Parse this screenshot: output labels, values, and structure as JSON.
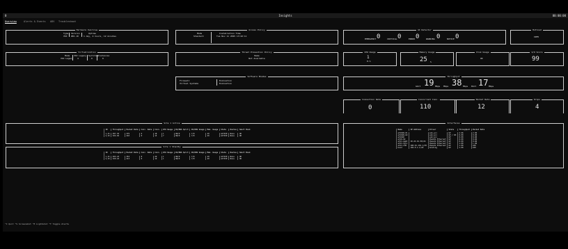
{
  "window": {
    "title": "Insights",
    "left_mark": "0",
    "clock": "00:00:00"
  },
  "tabs": [
    "Overview",
    "Alerts & Events",
    "ADV",
    "Troubleshoot"
  ],
  "hardware": {
    "title": "Hardware Overview",
    "headers": [
      "Type",
      "Version",
      "Uptime"
    ],
    "values": [
      "VSX",
      "R81.10",
      "1 day, 4 hours, 12 minutes"
    ]
  },
  "access_policy": {
    "title": "Access Policy",
    "left_header": "Mode",
    "left_value": "Standard",
    "right_header": "Installation Time",
    "right_value": "Tue Nov 11 2025 13:42:11"
  },
  "ai_detector": {
    "title": "AI Detector",
    "labels": [
      "EMERGENCY",
      "CRITICAL",
      "ERROR",
      "WARNING",
      "NOTICE"
    ],
    "values": [
      "0",
      "0",
      "0",
      "0",
      "0"
    ]
  },
  "hotload": {
    "title": "Hotload",
    "value": "INFO"
  },
  "virtualization": {
    "title": "Virtualization",
    "headers": [
      "Mode",
      "VSX Legacy",
      "Switches",
      "Instances"
    ],
    "row_label": "VSX Legacy",
    "values": [
      "4",
      "0",
      "0"
    ]
  },
  "threat_prevention": {
    "title": "Threat Prevention Policy",
    "label": "Name",
    "value": "Not Available"
  },
  "cpu": {
    "title": "CPU Usage",
    "value": "1",
    "unit": "0.%"
  },
  "memory": {
    "title": "Memory Usage",
    "value": "25",
    "unit": "%"
  },
  "disk": {
    "title": "Disk Usage",
    "value": "OK"
  },
  "io": {
    "title": "I/O Score",
    "value": "99"
  },
  "software_blades": {
    "title": "Software Blades",
    "items": [
      {
        "name": "Firewall",
        "status": "Evaluation"
      },
      {
        "name": "Virtual Systems",
        "status": "Evaluation"
      }
    ]
  },
  "throughput": {
    "title": "Throughput",
    "labels": [
      "Gbit",
      "Mbps",
      "Kbit"
    ],
    "values": [
      "19",
      "38",
      "17"
    ],
    "units": [
      "Mbps",
      "Mbps",
      "Mbps"
    ]
  },
  "kpis": [
    {
      "title": "Connection Rate",
      "value": "0"
    },
    {
      "title": "Concurrent Conn.",
      "value": "110"
    },
    {
      "title": "Packet Rate",
      "value": "12"
    },
    {
      "title": "Drops",
      "value": "4"
    }
  ],
  "vs_active": {
    "title": "Site 1 Active",
    "headers": [
      "ID",
      "Throughput",
      "Packet Rate",
      "Conc. Rate",
      "Conn.",
      "CPU Usage",
      "PA/DNS Split",
      "PA/DNS Usage",
      "Mem. Usage",
      "State",
      "Routes",
      "Smart Book"
    ],
    "rows": [
      [
        "1,41",
        "497.35",
        "379",
        "6",
        "18",
        "1",
        "98/0",
        "7/0",
        "29",
        "ACTIVE",
        "None",
        "OK"
      ],
      [
        "2,32",
        "324.02",
        "210",
        "0",
        "15",
        "7",
        "98/0",
        "7/0",
        "29",
        "ACTIVE",
        "None",
        "OK"
      ]
    ]
  },
  "vs_standby": {
    "title": "Site 1 Standby",
    "headers": [
      "ID",
      "Throughput",
      "Packet Rate",
      "Conc. Rate",
      "Conn.",
      "CPU Usage",
      "PA/DNS Split",
      "PA/DNS Usage",
      "Mem. Usage",
      "State",
      "Routes",
      "Smart Book"
    ],
    "rows": [
      [
        "1,41",
        "493.23",
        "353",
        "8",
        "20",
        "1",
        "98/0",
        "7/0",
        "29",
        "ACTIVE",
        "None",
        "OK"
      ],
      [
        "2,32",
        "320.24",
        "213",
        "0",
        "19",
        "1",
        "98/0",
        "7/0",
        "29",
        "ACTIVE",
        "None",
        "OK"
      ]
    ]
  },
  "interfaces": {
    "title": "Interfaces",
    "headers": [
      "Name",
      "IP Address",
      "Driver",
      "State",
      "Throughput",
      "Packet Rate"
    ],
    "rows": [
      [
        "eth0d0-01",
        "",
        "e1k_pci",
        "UP",
        "2.96",
        "2.96"
      ],
      [
        "eth0d0-02",
        "",
        "e1k_pci",
        "UP / RX",
        "0.00",
        "0.00"
      ],
      [
        "eth0d0",
        "",
        "e1k_pci",
        "UP",
        "0.00",
        "0.00"
      ],
      [
        "eth0-02",
        "",
        "Pseudo Ethernet",
        "UP",
        "0.00",
        "0.00"
      ],
      [
        "eth1-mgmt",
        "10.22.91.50/24",
        "Pseudo Ethernet",
        "UP",
        "0.00",
        "0.00"
      ],
      [
        "eth1-Sync",
        "",
        "Pseudo Ethernet",
        "UP",
        "1.00",
        "1.00"
      ],
      [
        "eth1-CCB",
        "100.91.101.1/25",
        "Pseudo Ethernet",
        "UP",
        "1.00",
        "100"
      ],
      [
        "bond",
        "192.0.1.1/20",
        "bonding",
        "UP",
        "1.00",
        "100"
      ]
    ]
  },
  "status_bar": {
    "text": "^C Quit  ^S Screenshot  ^E Lightshot  ^T Toggle Alerts"
  }
}
